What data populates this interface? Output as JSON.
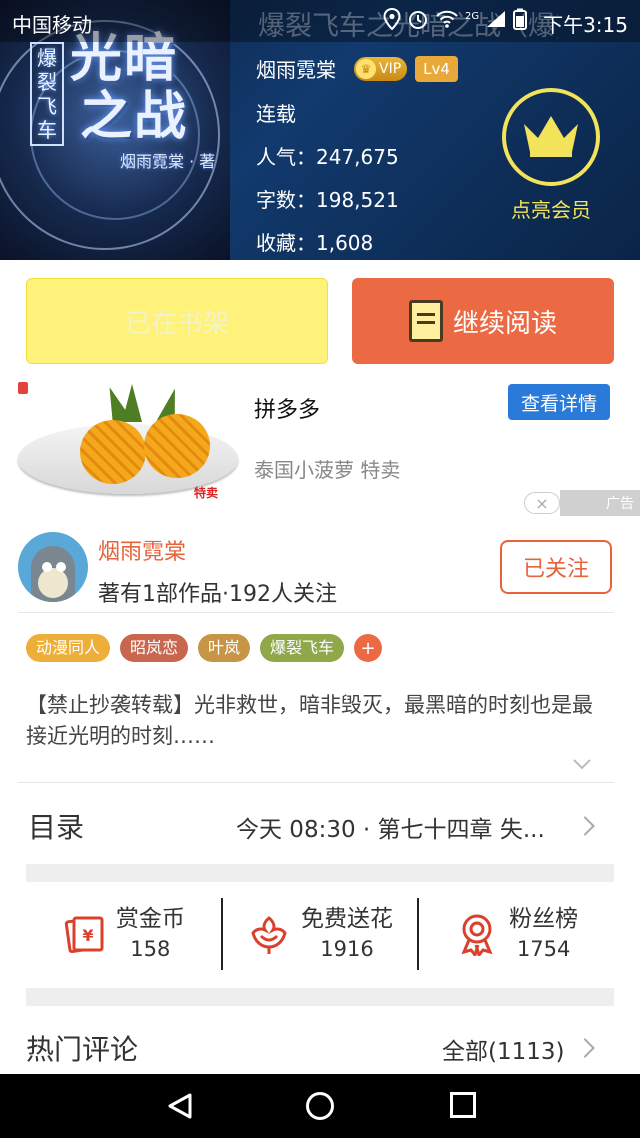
{
  "status_bar": {
    "carrier": "中国移动",
    "faded_title": "爆裂飞车之光暗之战（爆)",
    "network": "2G",
    "time": "下午3:15"
  },
  "cover": {
    "title_line1": "光暗",
    "title_line2": "之战",
    "vertical_tag": "爆裂飞车",
    "author_credit": "烟雨霓棠 · 著"
  },
  "book_info": {
    "author": "烟雨霓棠",
    "vip_badge": "VIP",
    "level": "Lv4",
    "status": "连载",
    "popularity": "人气：247,675",
    "word_count": "字数：198,521",
    "favorites": "收藏：1,608",
    "vip_cta": "点亮会员"
  },
  "actions": {
    "shelf_label": "已在书架",
    "read_label": "继续阅读"
  },
  "ad": {
    "title": "拼多多",
    "description": "泰国小菠萝 特卖",
    "button": "查看详情",
    "image_tag": "特卖",
    "label": "广告",
    "close": "×"
  },
  "author": {
    "name": "烟雨霓棠",
    "meta": "著有1部作品·192人关注",
    "follow_label": "已关注"
  },
  "tags": [
    {
      "label": "动漫同人",
      "color": "#eeae3a"
    },
    {
      "label": "昭岚恋",
      "color": "#c9674e"
    },
    {
      "label": "叶岚",
      "color": "#c69646"
    },
    {
      "label": "爆裂飞车",
      "color": "#8fa84a"
    }
  ],
  "tag_add_label": "+",
  "synopsis": "【禁止抄袭转载】光非救世，暗非毁灭，最黑暗的时刻也是最接近光明的时刻……",
  "toc": {
    "title": "目录",
    "latest": "今天 08:30 · 第七十四章  失..."
  },
  "stats": [
    {
      "label": "赏金币",
      "value": "158",
      "icon": "red-envelope-yuan-icon"
    },
    {
      "label": "免费送花",
      "value": "1916",
      "icon": "flower-icon"
    },
    {
      "label": "粉丝榜",
      "value": "1754",
      "icon": "medal-ribbon-icon"
    }
  ],
  "comments": {
    "title": "热门评论",
    "all_label": "全部(1113)"
  },
  "colors": {
    "accent_orange": "#ec6a43",
    "shelf_yellow": "#fff27a",
    "vip_gold": "#f3e35a",
    "ad_blue": "#2a7ad9",
    "icon_red": "#d9412c"
  }
}
